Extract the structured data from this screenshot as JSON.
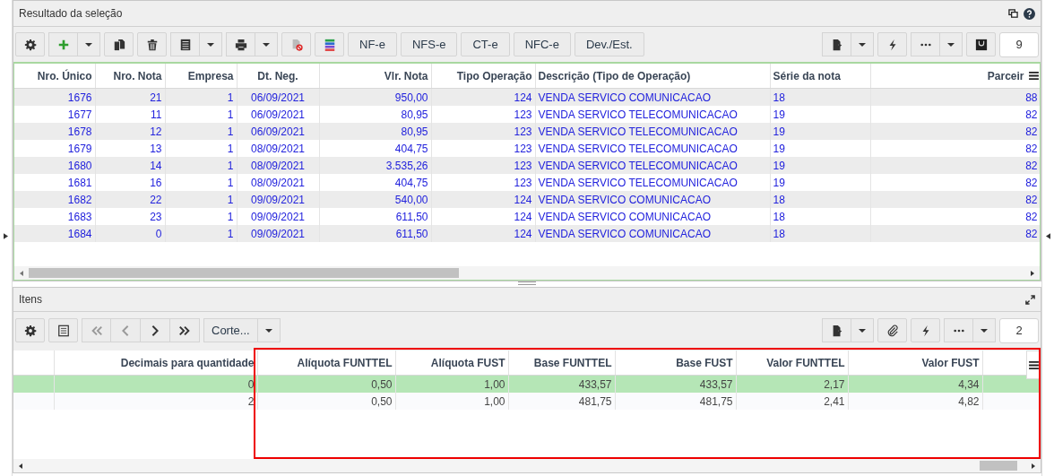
{
  "top_panel": {
    "title": "Resultado da seleção",
    "toolbar_buttons": [
      "NF-e",
      "NFS-e",
      "CT-e",
      "NFC-e",
      "Dev./Est."
    ],
    "page_count": "9",
    "columns": [
      "Nro. Único",
      "Nro. Nota",
      "Empresa",
      "Dt. Neg.",
      "Vlr. Nota",
      "Tipo Operação",
      "Descrição (Tipo de Operação)",
      "Série da nota",
      "Parceir"
    ],
    "rows": [
      [
        "1676",
        "21",
        "1",
        "06/09/2021",
        "950,00",
        "124",
        "VENDA SERVICO COMUNICACAO",
        "18",
        "88"
      ],
      [
        "1677",
        "11",
        "1",
        "06/09/2021",
        "80,95",
        "123",
        "VENDA SERVICO TELECOMUNICACAO",
        "19",
        "82"
      ],
      [
        "1678",
        "12",
        "1",
        "06/09/2021",
        "80,95",
        "123",
        "VENDA SERVICO TELECOMUNICACAO",
        "19",
        "82"
      ],
      [
        "1679",
        "13",
        "1",
        "08/09/2021",
        "404,75",
        "123",
        "VENDA SERVICO TELECOMUNICACAO",
        "19",
        "82"
      ],
      [
        "1680",
        "14",
        "1",
        "08/09/2021",
        "3.535,26",
        "123",
        "VENDA SERVICO TELECOMUNICACAO",
        "19",
        "82"
      ],
      [
        "1681",
        "16",
        "1",
        "08/09/2021",
        "404,75",
        "123",
        "VENDA SERVICO TELECOMUNICACAO",
        "19",
        "82"
      ],
      [
        "1682",
        "22",
        "1",
        "09/09/2021",
        "540,00",
        "124",
        "VENDA SERVICO COMUNICACAO",
        "18",
        "82"
      ],
      [
        "1683",
        "23",
        "1",
        "09/09/2021",
        "611,50",
        "124",
        "VENDA SERVICO COMUNICACAO",
        "18",
        "82"
      ],
      [
        "1684",
        "0",
        "1",
        "09/09/2021",
        "611,50",
        "124",
        "VENDA SERVICO COMUNICACAO",
        "18",
        "82"
      ]
    ]
  },
  "items_panel": {
    "title": "Itens",
    "cut_button": "Corte...",
    "page_count": "2",
    "columns": [
      "Decimais para quantidade",
      "Alíquota FUNTTEL",
      "Alíquota FUST",
      "Base FUNTTEL",
      "Base FUST",
      "Valor FUNTTEL",
      "Valor FUST"
    ],
    "rows": [
      {
        "selected": true,
        "cells": [
          "0",
          "0,50",
          "1,00",
          "433,57",
          "433,57",
          "2,17",
          "4,34"
        ]
      },
      {
        "selected": false,
        "cells": [
          "2",
          "0,50",
          "1,00",
          "481,75",
          "481,75",
          "2,41",
          "4,82"
        ]
      }
    ]
  }
}
